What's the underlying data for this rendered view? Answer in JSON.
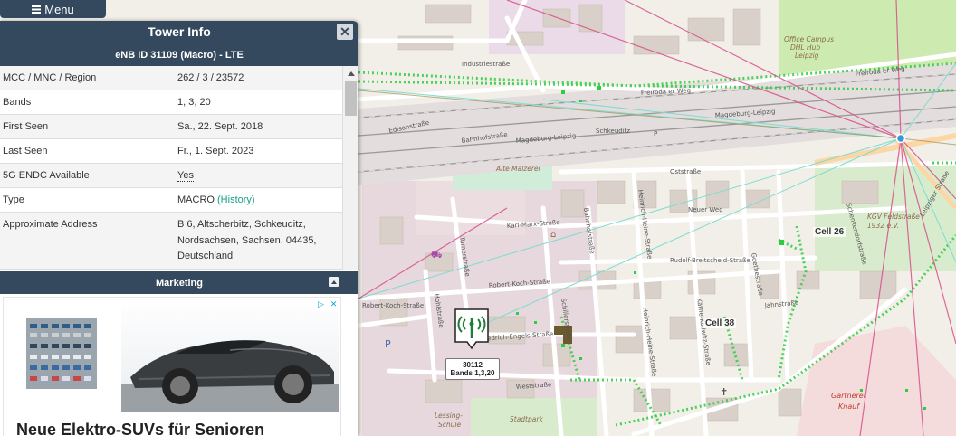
{
  "menu": {
    "label": "Menu"
  },
  "panel": {
    "title": "Tower Info",
    "enb_title": "eNB ID 31109 (Macro) - LTE",
    "rows": [
      {
        "key": "MCC / MNC / Region",
        "value": "262 / 3 / 23572"
      },
      {
        "key": "Bands",
        "value": "1, 3, 20"
      },
      {
        "key": "First Seen",
        "value": "Sa., 22. Sept. 2018"
      },
      {
        "key": "Last Seen",
        "value": "Fr., 1. Sept. 2023"
      },
      {
        "key": "5G ENDC Available",
        "value": "Yes"
      },
      {
        "key": "Type",
        "value": "MACRO",
        "link": "(History)"
      },
      {
        "key": "Approximate Address",
        "lines": [
          "B 6, Altscherbitz, Schkeuditz,",
          "Nordsachsen, Sachsen, 04435,",
          "Deutschland"
        ]
      }
    ]
  },
  "marketing": {
    "title": "Marketing",
    "ad_headline": "Neue Elektro-SUVs für Senioren"
  },
  "map": {
    "tower_marker": {
      "line1": "30112",
      "line2": "Bands 1,3,20"
    },
    "cell_labels": [
      "Cell 26",
      "Cell 38"
    ],
    "streets": [
      "Industriestraße",
      "Freiroda er Weg",
      "Edisonstraße",
      "Bahnhofstraße",
      "Magdeburg-Leipzig",
      "Schkeuditz",
      "Oststraße",
      "Neuer Weg",
      "Karl-Marx-Straße",
      "Rudolf-Breitscheid-Straße",
      "Robert-Koch-Straße",
      "Friedrich-Engels-Straße",
      "Weststraße",
      "Jahnstraße",
      "Goethestraße",
      "Heinrich-Heine-Straße",
      "Schillerstraße",
      "Käthe-Kollwitz-Straße",
      "Bahnhofstraße",
      "Turnerstraße",
      "Hohlstraße",
      "Heinrich-Heine-Straße",
      "Schenkendorfstraße",
      "Leipziger Straße",
      "Freiroda er Weg",
      "Magdeburg-Leipzig"
    ],
    "pois": [
      "Office Campus",
      "DHL Hub",
      "Leipzig",
      "Alte Mälzerei",
      "KGV Feldstraße",
      "1932 e.V.",
      "Lessing-",
      "Schule",
      "Stadtpark",
      "Gärtnerei",
      "Knauf"
    ]
  },
  "colors": {
    "panel_header": "#34495e",
    "history_link": "#16a085",
    "coverage_green": "#2ecc40",
    "line_pink": "#d64f8a",
    "line_cyan": "#7fdcd0"
  }
}
